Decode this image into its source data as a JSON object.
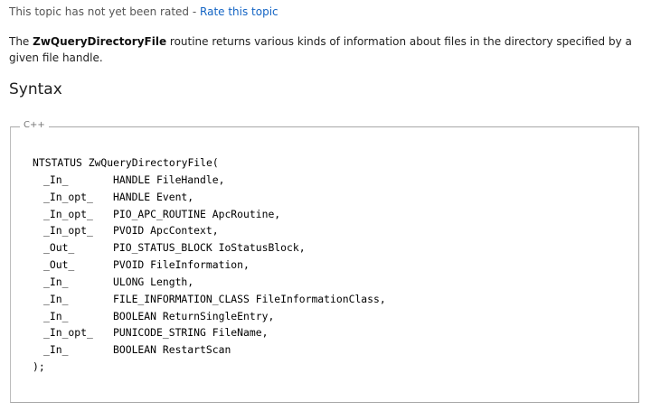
{
  "rating": {
    "status_text": "This topic has not yet been rated",
    "separator": " - ",
    "link_label": "Rate this topic"
  },
  "description": {
    "intro": "The ",
    "routine_name": "ZwQueryDirectoryFile",
    "rest": " routine returns various kinds of information about files in the directory specified by a given file handle."
  },
  "syntax": {
    "heading": "Syntax",
    "language_label": "C++",
    "signature_open": "NTSTATUS ZwQueryDirectoryFile(",
    "params": [
      {
        "annotation": "_In_",
        "declaration": "HANDLE FileHandle,"
      },
      {
        "annotation": "_In_opt_",
        "declaration": "HANDLE Event,"
      },
      {
        "annotation": "_In_opt_",
        "declaration": "PIO_APC_ROUTINE ApcRoutine,"
      },
      {
        "annotation": "_In_opt_",
        "declaration": "PVOID ApcContext,"
      },
      {
        "annotation": "_Out_",
        "declaration": "PIO_STATUS_BLOCK IoStatusBlock,"
      },
      {
        "annotation": "_Out_",
        "declaration": "PVOID FileInformation,"
      },
      {
        "annotation": "_In_",
        "declaration": "ULONG Length,"
      },
      {
        "annotation": "_In_",
        "declaration": "FILE_INFORMATION_CLASS FileInformationClass,"
      },
      {
        "annotation": "_In_",
        "declaration": "BOOLEAN ReturnSingleEntry,"
      },
      {
        "annotation": "_In_opt_",
        "declaration": "PUNICODE_STRING FileName,"
      },
      {
        "annotation": "_In_",
        "declaration": "BOOLEAN RestartScan"
      }
    ],
    "signature_close": ");"
  }
}
